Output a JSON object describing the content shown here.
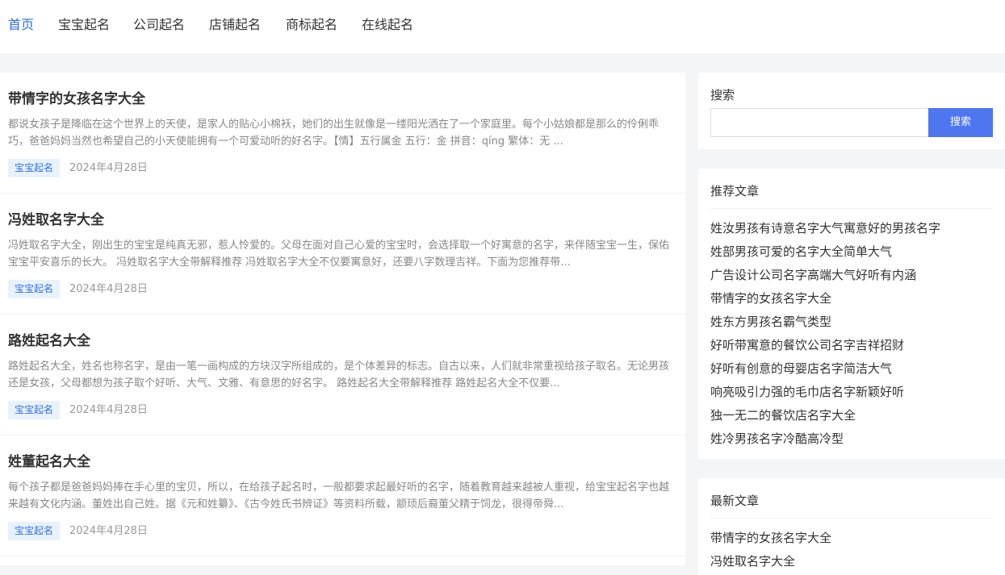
{
  "nav": {
    "items": [
      {
        "label": "首页",
        "active": true
      },
      {
        "label": "宝宝起名",
        "active": false
      },
      {
        "label": "公司起名",
        "active": false
      },
      {
        "label": "店铺起名",
        "active": false
      },
      {
        "label": "商标起名",
        "active": false
      },
      {
        "label": "在线起名",
        "active": false
      }
    ]
  },
  "articles": [
    {
      "title": "带情字的女孩名字大全",
      "excerpt": "都说女孩子是降临在这个世界上的天使，是家人的贴心小棉袄，她们的出生就像是一缕阳光洒在了一个家庭里。每个小姑娘都是那么的伶俐乖巧，爸爸妈妈当然也希望自己的小天使能拥有一个可爱动听的好名字。【情】五行属金 五行：金 拼音：qíng 繁体：无 ...",
      "tag": "宝宝起名",
      "date": "2024年4月28日"
    },
    {
      "title": "冯姓取名字大全",
      "excerpt": "冯姓取名字大全，刚出生的宝宝是纯真无邪，惹人怜爱的。父母在面对自己心爱的宝宝时，会选择取一个好寓意的名字，来伴随宝宝一生，保佑宝宝平安喜乐的长大。 冯姓取名字大全带解释推荐 冯姓取名字大全不仅要寓意好，还要八字数理吉祥。下面为您推荐带...",
      "tag": "宝宝起名",
      "date": "2024年4月28日"
    },
    {
      "title": "路姓起名大全",
      "excerpt": "路姓起名大全，姓名也称名字，是由一笔一画构成的方块汉字所组成的，是个体差异的标志。自古以来，人们就非常重视给孩子取名。无论男孩还是女孩，父母都想为孩子取个好听、大气、文雅、有意思的好名字。 路姓起名大全带解释推荐 路姓起名大全不仅要...",
      "tag": "宝宝起名",
      "date": "2024年4月28日"
    },
    {
      "title": "姓董起名大全",
      "excerpt": "每个孩子都是爸爸妈妈捧在手心里的宝贝，所以，在给孩子起名时，一般都要求起最好听的名字，随着教育越来越被人重视，给宝宝起名字也越来越有文化内涵。董姓出自己姓。据《元和姓纂》、《古今姓氏书辨证》等资料所载，颛顼后裔董父精于饲龙，很得帝舜...",
      "tag": "宝宝起名",
      "date": "2024年4月28日"
    }
  ],
  "search": {
    "title": "搜索",
    "placeholder": "",
    "button_label": "搜索"
  },
  "recommended": {
    "title": "推荐文章",
    "items": [
      "姓汝男孩有诗意名字大气寓意好的男孩名字",
      "姓部男孩可爱的名字大全简单大气",
      "广告设计公司名字高端大气好听有内涵",
      "带情字的女孩名字大全",
      "姓东方男孩名霸气类型",
      "好听带寓意的餐饮公司名字吉祥招财",
      "好听有创意的母婴店名字简洁大气",
      "响亮吸引力强的毛巾店名字新颖好听",
      "独一无二的餐饮店名字大全",
      "姓冷男孩名字冷酷高冷型"
    ]
  },
  "latest": {
    "title": "最新文章",
    "items": [
      "带情字的女孩名字大全",
      "冯姓取名字大全"
    ]
  }
}
